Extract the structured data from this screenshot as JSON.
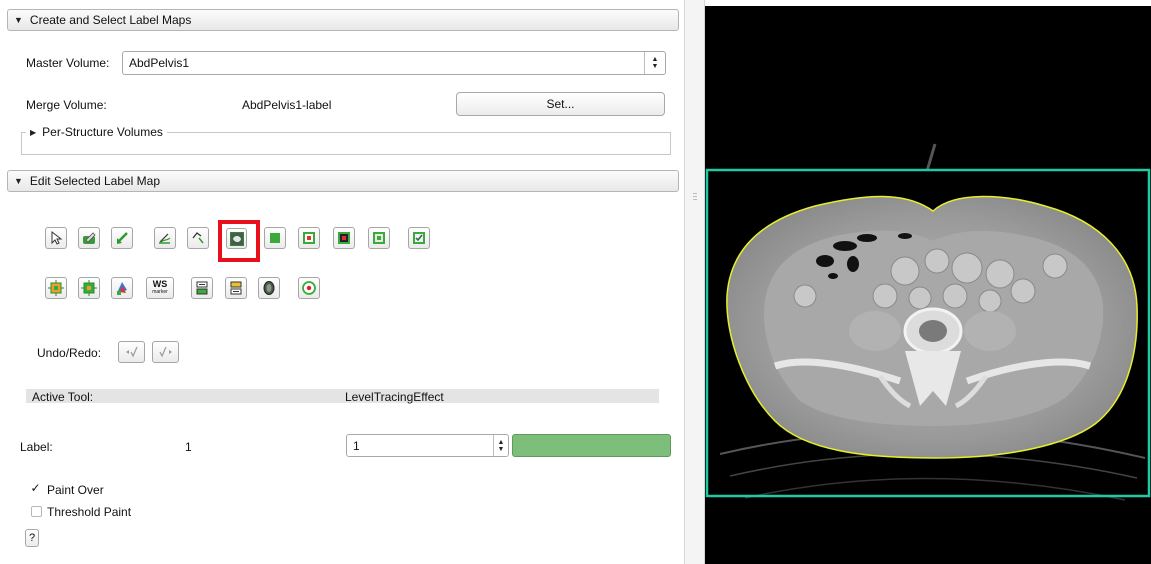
{
  "sections": {
    "create": {
      "title": "Create and Select Label Maps"
    },
    "edit": {
      "title": "Edit Selected Label Map"
    }
  },
  "master_volume": {
    "label": "Master Volume:",
    "value": "AbdPelvis1"
  },
  "merge_volume": {
    "label": "Merge Volume:",
    "value": "AbdPelvis1-label",
    "set_button": "Set..."
  },
  "per_structure": {
    "title": "Per-Structure Volumes"
  },
  "tools": {
    "row1": [
      "arrow-icon",
      "paint-icon",
      "draw-icon",
      "level-tracing-icon",
      "draw-freehand-icon",
      "level-tracing-effect-icon",
      "rectangle-icon",
      "grow-cut-icon",
      "threshold-icon",
      "change-island-icon",
      "remove-islands-icon"
    ],
    "row2": [
      "dilate-icon",
      "erode-icon",
      "identify-islands-icon",
      "ws-marker-icon",
      "change-label-icon",
      "make-model-icon",
      "fast-marching-icon",
      "goto-label-icon"
    ],
    "ws_text": "WS",
    "ws_sub": "marker",
    "selected_index": 5,
    "selected_color": "#e8101a"
  },
  "undo_redo": {
    "label": "Undo/Redo:"
  },
  "active_tool": {
    "label": "Active Tool:",
    "value": "LevelTracingEffect"
  },
  "label_row": {
    "label": "Label:",
    "value": "1",
    "spin_value": "1",
    "color": "#7dbf7a"
  },
  "paint_over": {
    "label": "Paint Over",
    "checked": true
  },
  "threshold_paint": {
    "label": "Threshold Paint",
    "checked": false
  },
  "help_button": "?",
  "viewer": {
    "box_color": "#1fc9a2",
    "outline_color": "#e7ef2a"
  }
}
